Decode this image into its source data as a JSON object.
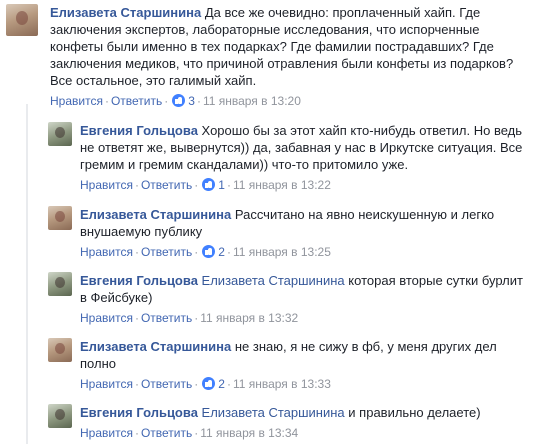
{
  "comments": [
    {
      "author": "Елизавета Старшинина",
      "mention": "",
      "text": "Да все же очевидно: проплаченный хайп. Где заключения экспертов, лабораторные исследования, что испорченные конфеты были именно в тех подарках? Где фамилии пострадавших? Где заключения медиков, что причиной отравления были конфеты из подарков? Все остальное, это галимый хайп.",
      "like_label": "Нравится",
      "reply_label": "Ответить",
      "likes": "3",
      "time": "11 января в 13:20"
    },
    {
      "author": "Евгения Гольцова",
      "mention": "",
      "text": "Хорошо бы за этот хайп кто-нибудь ответил. Но ведь не ответят же, вывернутся)) да, забавная у нас в Иркутске ситуация. Все гремим и гремим скандалами)) что-то притомило уже.",
      "like_label": "Нравится",
      "reply_label": "Ответить",
      "likes": "1",
      "time": "11 января в 13:22"
    },
    {
      "author": "Елизавета Старшинина",
      "mention": "",
      "text": "Рассчитано на явно неискушенную и легко внушаемую публику",
      "like_label": "Нравится",
      "reply_label": "Ответить",
      "likes": "2",
      "time": "11 января в 13:25"
    },
    {
      "author": "Евгения Гольцова",
      "mention": "Елизавета Старшинина",
      "text": "которая вторые сутки бурлит в Фейсбуке)",
      "like_label": "Нравится",
      "reply_label": "Ответить",
      "likes": "",
      "time": "11 января в 13:32"
    },
    {
      "author": "Елизавета Старшинина",
      "mention": "",
      "text": "не знаю, я не сижу в фб, у меня других дел полно",
      "like_label": "Нравится",
      "reply_label": "Ответить",
      "likes": "2",
      "time": "11 января в 13:33"
    },
    {
      "author": "Евгения Гольцова",
      "mention": "Елизавета Старшинина",
      "text": "и правильно делаете)",
      "like_label": "Нравится",
      "reply_label": "Ответить",
      "likes": "",
      "time": "11 января в 13:34"
    }
  ],
  "colors": {
    "link": "#365899",
    "action_link": "#4267b2",
    "meta": "#90949c",
    "like_badge": "#4080ff"
  },
  "icons": [
    "like-icon"
  ]
}
